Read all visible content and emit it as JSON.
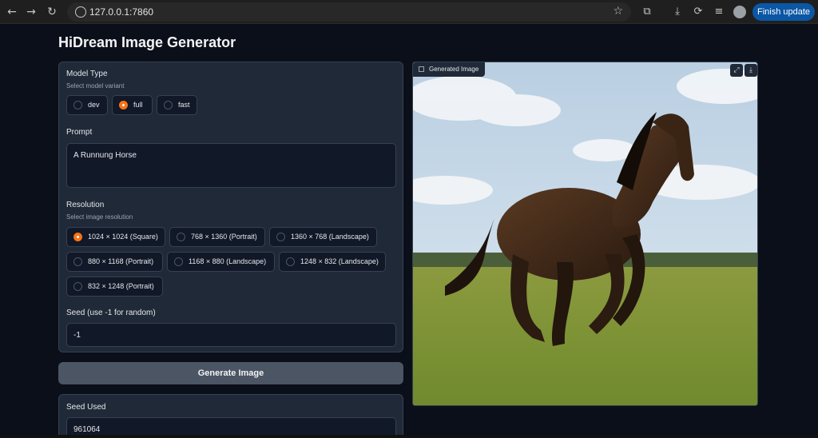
{
  "browser": {
    "url": "127.0.0.1:7860",
    "finish_update": "Finish update",
    "icons": [
      "back-icon",
      "forward-icon",
      "reload-icon",
      "site-info-icon",
      "star-icon",
      "extensions-icon",
      "download-icon",
      "sync-icon",
      "media-icon",
      "profile-icon"
    ]
  },
  "app": {
    "title": "HiDream Image Generator"
  },
  "model": {
    "label": "Model Type",
    "sublabel": "Select model variant",
    "options": [
      "dev",
      "full",
      "fast"
    ],
    "selected": "full"
  },
  "prompt": {
    "label": "Prompt",
    "value": "A Runnung Horse"
  },
  "resolution": {
    "label": "Resolution",
    "sublabel": "Select image resolution",
    "options": [
      "1024 × 1024 (Square)",
      "768 × 1360 (Portrait)",
      "1360 × 768 (Landscape)",
      "880 × 1168 (Portrait)",
      "1168 × 880 (Landscape)",
      "1248 × 832 (Landscape)",
      "832 × 1248 (Portrait)"
    ],
    "selected": "1024 × 1024 (Square)"
  },
  "seed": {
    "label": "Seed (use -1 for random)",
    "value": "-1"
  },
  "generate_button": "Generate Image",
  "seed_used": {
    "label": "Seed Used",
    "value": "961064"
  },
  "output": {
    "label": "Generated Image",
    "actions": [
      "fullscreen-icon",
      "download-icon"
    ]
  }
}
